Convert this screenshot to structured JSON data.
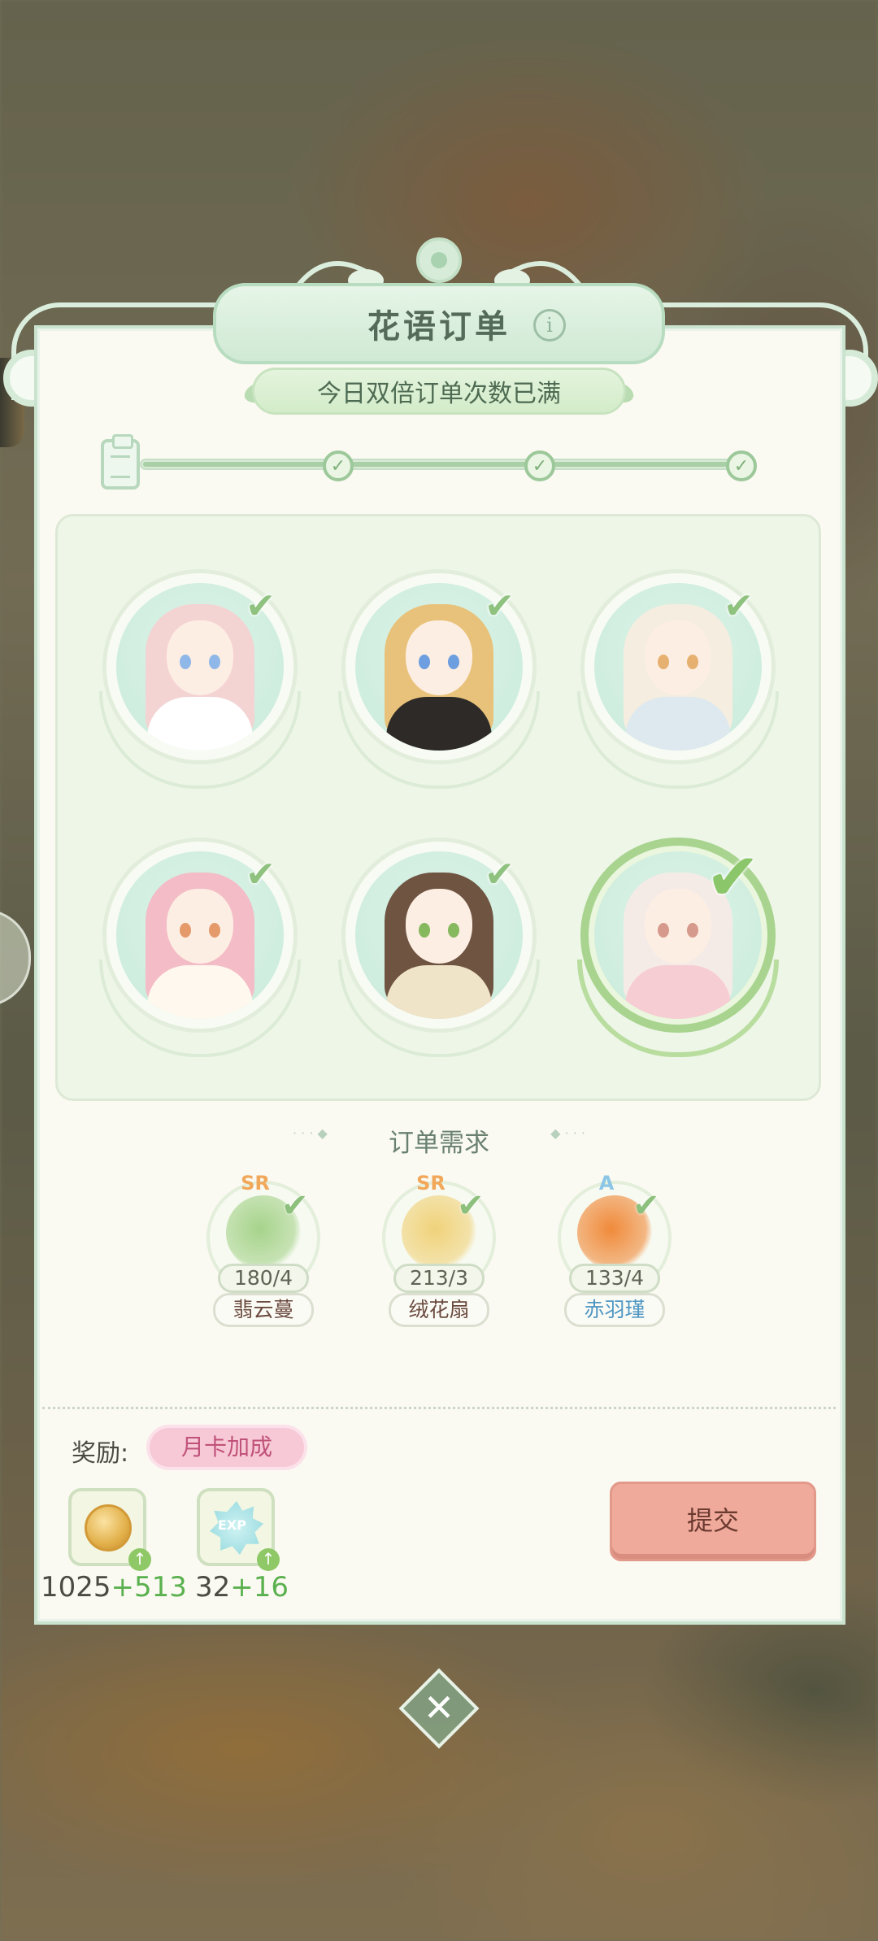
{
  "title": "花语订单",
  "double_banner": "今日双倍订单次数已满",
  "progress": {
    "milestones_completed": 3,
    "milestones_total": 3,
    "fill": 1.0
  },
  "characters": [
    {
      "hair": "#f4d3d3",
      "body": "#ffffff",
      "eye": "#8fb8e8",
      "done": true
    },
    {
      "hair": "#e8c27a",
      "body": "#2d2a28",
      "eye": "#6d9ee0",
      "done": true
    },
    {
      "hair": "#f4ede0",
      "body": "#dde9ee",
      "eye": "#e6b071",
      "done": true
    },
    {
      "hair": "#f3bcc6",
      "body": "#fff8ee",
      "eye": "#e59a6a",
      "done": true
    },
    {
      "hair": "#6f5442",
      "body": "#efe3c8",
      "eye": "#86b85e",
      "done": true
    },
    {
      "hair": "#f5ebe6",
      "body": "#f6cdd3",
      "eye": "#d69a8c",
      "done": true,
      "selected": true
    }
  ],
  "requirements_title": "订单需求",
  "requirements": [
    {
      "rarity": "SR",
      "count": "180/4",
      "name": "翡云蔓",
      "flower_color": "#a6d38b",
      "rarity_color": "#f1a85a",
      "name_color": "#6b4a3e"
    },
    {
      "rarity": "SR",
      "count": "213/3",
      "name": "绒花扇",
      "flower_color": "#f0d27a",
      "rarity_color": "#f1a85a",
      "name_color": "#6b4a3e"
    },
    {
      "rarity": "A",
      "count": "133/4",
      "name": "赤羽瑾",
      "flower_color": "#f08a3a",
      "rarity_color": "#8cc6e6",
      "name_color": "#4f97c2"
    }
  ],
  "reward": {
    "label": "奖励:",
    "monthly_card": "月卡加成",
    "items": [
      {
        "icon": "coin-icon",
        "base": "1025",
        "bonus": "+513"
      },
      {
        "icon": "exp-icon",
        "icon_text": "EXP",
        "base": "32",
        "bonus": "+16"
      }
    ]
  },
  "submit_label": "提交",
  "close_glyph": "✕",
  "colors": {
    "panel": "#fbfaf2",
    "accent_green": "#8cc66a",
    "submit": "#efaa9b"
  }
}
